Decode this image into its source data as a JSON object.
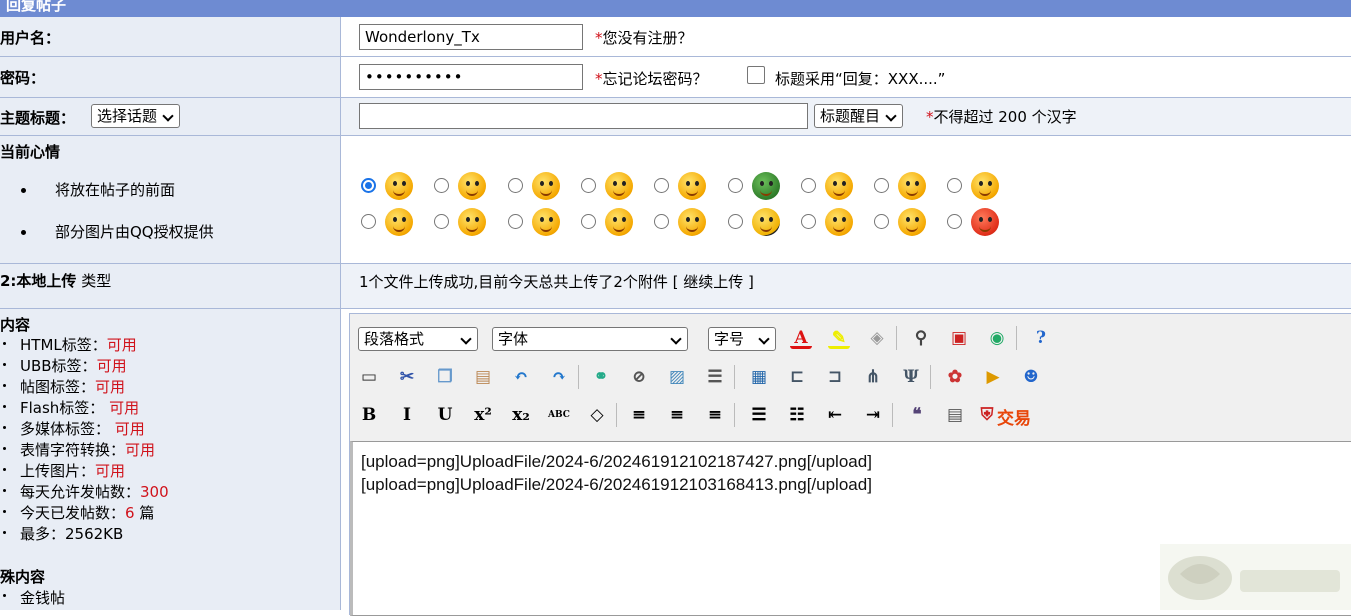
{
  "header": {
    "title": "回复帖子"
  },
  "username": {
    "label": "用户名：",
    "value": "Wonderlony_Tx",
    "note_star": "*",
    "note": "您没有注册？"
  },
  "password": {
    "label": "密码：",
    "value": "••••••••••",
    "note_star": "*",
    "note": "忘记论坛密码？",
    "checkbox_label": "标题采用“回复：XXX....”"
  },
  "subject": {
    "label": "主题标题：",
    "topic_select": "选择话题",
    "title_value": "",
    "style_select": "标题醒目",
    "note_star": "*",
    "note": "不得超过 200 个汉字"
  },
  "mood": {
    "label": "当前心情",
    "bullets": [
      "将放在帖子的前面",
      "部分图片由QQ授权提供"
    ],
    "icons_row1": [
      "smile-face-icon",
      "yawn-face-icon",
      "blush-face-icon",
      "heart-eyes-face-icon",
      "tongue-face-icon",
      "army-face-icon",
      "question-face-icon",
      "cool-face-icon",
      "surprised-face-icon"
    ],
    "icons_row2": [
      "confused-face-icon",
      "angry-face-icon",
      "crying-face-icon",
      "scream-face-icon",
      "wink-face-icon",
      "skull-face-icon",
      "sad-face-icon",
      "hammer-face-icon",
      "furious-face-icon"
    ],
    "selected_index": 0
  },
  "upload": {
    "label": "2:本地上传",
    "type_label": "类型",
    "status": "1个文件上传成功,目前今天总共上传了2个附件 [ 继续上传 ]"
  },
  "content": {
    "label": "内容",
    "rules": [
      {
        "label": "HTML标签：",
        "value": "可用"
      },
      {
        "label": "UBB标签：",
        "value": "可用"
      },
      {
        "label": "帖图标签：",
        "value": "可用"
      },
      {
        "label": "Flash标签： ",
        "value": "可用"
      },
      {
        "label": "多媒体标签： ",
        "value": "可用"
      },
      {
        "label": "表情字符转换：",
        "value": "可用"
      },
      {
        "label": "上传图片：",
        "value": "可用"
      },
      {
        "label": "每天允许发帖数：",
        "value": "300"
      },
      {
        "label": "今天已发帖数：",
        "value": "6",
        "suffix": " 篇"
      },
      {
        "label": "最多：2562KB",
        "value": ""
      }
    ],
    "special_label": "殊内容",
    "special_items": [
      "金钱帖"
    ]
  },
  "editor": {
    "format_select": "段落格式",
    "font_select": "字体",
    "size_select": "字号",
    "trade_label": "交易",
    "text_lines": [
      "[upload=png]UploadFile/2024-6/20246191210218​7427.png[/upload]",
      "[upload=png]UploadFile/2024-6/20246191210316​8413.png[/upload]"
    ]
  },
  "colors": {
    "header_bg": "#6e8bd2",
    "label_bg": "#e8edf5",
    "required": "#d0121b",
    "accent": "#1a73e8"
  }
}
